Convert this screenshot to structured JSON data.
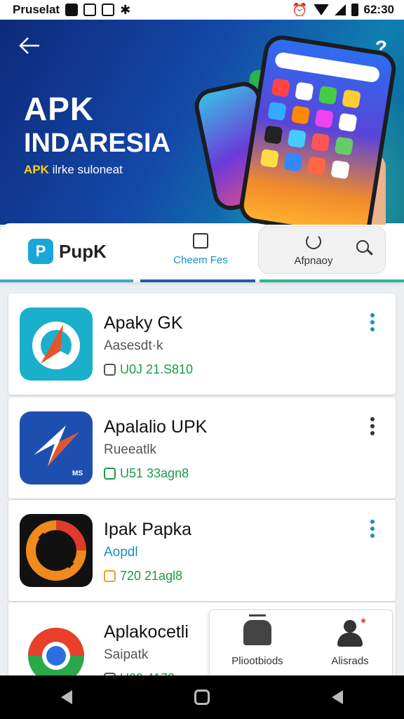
{
  "status_bar": {
    "carrier": "Pruselat",
    "time": "62:30"
  },
  "hero": {
    "title_line1": "APK",
    "title_line2": "INDARESIA",
    "subtitle_accent": "APK",
    "subtitle_rest": " ilrke suloneat"
  },
  "tabs": {
    "brand_name": "PupK",
    "brand_logo_letter": "P",
    "cheap_label": "Cheem Fes",
    "afp_label": "Afpnaoy"
  },
  "apps": [
    {
      "name": "Apaky GK",
      "sub": "Aasesdt·k",
      "meta": "U0J 21.S810",
      "meta_color": "#1a9a4a",
      "icon_name": "compass-arrow-icon",
      "more_color": "#1a8fc0"
    },
    {
      "name": "Apalalio UPK",
      "sub": "Rueeatlk",
      "meta": "U51 33agn8",
      "meta_color": "#1a9a4a",
      "icon_name": "lightning-icon",
      "icon_badge": "MS",
      "more_color": "#333333"
    },
    {
      "name": "Ipak Papka",
      "sub": "Aopdl",
      "meta": "720 21agl8",
      "meta_color": "#1a9a4a",
      "sub_color": "#1a8fc0",
      "icon_name": "ring-logo-icon",
      "more_color": "#1a8fc0"
    },
    {
      "name": "Aplakocetli",
      "sub": "Saipatk",
      "meta": "U00 4172",
      "meta_color": "#1a9a4a",
      "icon_name": "chrome-like-icon"
    }
  ],
  "float_panel": {
    "android_label": "Pliootbiods",
    "profile_label": "Alisrads"
  },
  "colors": {
    "accent": "#1a8fc0",
    "hero_yellow": "#ffd400"
  }
}
